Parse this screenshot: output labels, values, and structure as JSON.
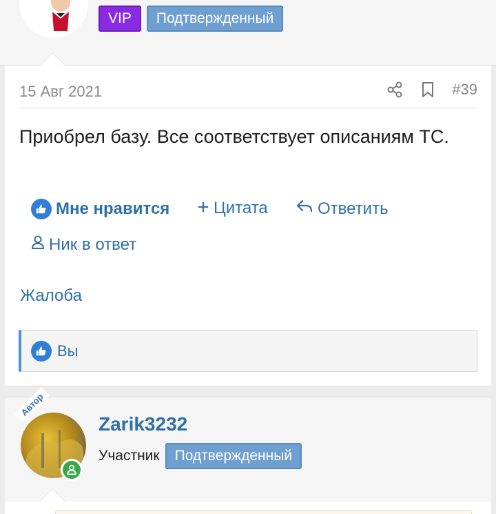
{
  "top_user": {
    "badges": [
      "VIP",
      "Подтвержденный"
    ]
  },
  "post": {
    "date": "15 Авг 2021",
    "number": "#39",
    "body": "Приобрел базу. Все соответствует описаниям ТС.",
    "actions": {
      "like": "Мне нравится",
      "quote": "Цитата",
      "reply": "Ответить",
      "nick_reply": "Ник в ответ"
    },
    "report": "Жалоба",
    "likes": "Вы"
  },
  "user2": {
    "ribbon": "Автор",
    "name": "Zarik3232",
    "role": "Участник",
    "badge": "Подтвержденный"
  },
  "colors": {
    "accent": "#2f6fa8",
    "vip": "#8a2be2",
    "verified_badge": "#6f9fd0",
    "online": "#3aa84a"
  }
}
